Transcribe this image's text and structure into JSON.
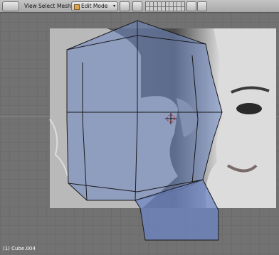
{
  "header": {
    "menus": [
      "View",
      "Select",
      "Mesh"
    ],
    "mode": "Edit Mode"
  },
  "viewport": {
    "object_info": "(1) Cube.004",
    "background_image": "face reference photo",
    "mesh_color": "#6e86c4"
  },
  "icons": {
    "viewtype": "3d-view-icon",
    "pivot": "pivot-icon",
    "manipulator": "manipulator-icon",
    "lock": "lock-icon",
    "render": "render-icon"
  }
}
